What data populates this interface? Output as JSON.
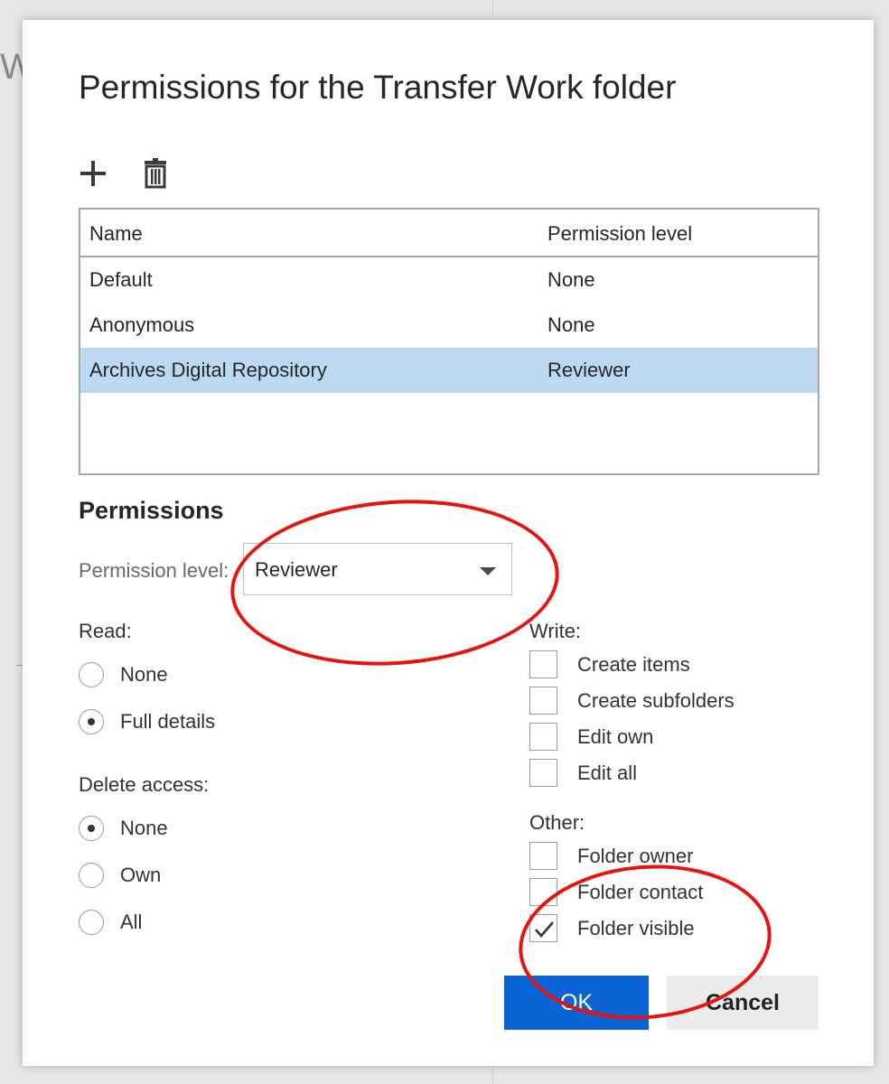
{
  "background": {
    "partial_letter": "W"
  },
  "dialog": {
    "title": "Permissions for the Transfer Work folder",
    "toolbar": {
      "add_icon": "plus-icon",
      "delete_icon": "trash-icon"
    },
    "table": {
      "columns": [
        "Name",
        "Permission level"
      ],
      "rows": [
        {
          "name": "Default",
          "level": "None",
          "selected": false
        },
        {
          "name": "Anonymous",
          "level": "None",
          "selected": false
        },
        {
          "name": "Archives Digital Repository",
          "level": "Reviewer",
          "selected": true
        }
      ]
    },
    "permissions": {
      "section_title": "Permissions",
      "permission_level_label": "Permission level:",
      "permission_level_value": "Reviewer",
      "read": {
        "label": "Read:",
        "options": [
          {
            "label": "None",
            "checked": false
          },
          {
            "label": "Full details",
            "checked": true
          }
        ]
      },
      "delete_access": {
        "label": "Delete access:",
        "options": [
          {
            "label": "None",
            "checked": true
          },
          {
            "label": "Own",
            "checked": false
          },
          {
            "label": "All",
            "checked": false
          }
        ]
      },
      "write": {
        "label": "Write:",
        "options": [
          {
            "label": "Create items",
            "checked": false
          },
          {
            "label": "Create subfolders",
            "checked": false
          },
          {
            "label": "Edit own",
            "checked": false
          },
          {
            "label": "Edit all",
            "checked": false
          }
        ]
      },
      "other": {
        "label": "Other:",
        "options": [
          {
            "label": "Folder owner",
            "checked": false
          },
          {
            "label": "Folder contact",
            "checked": false
          },
          {
            "label": "Folder visible",
            "checked": true
          }
        ]
      }
    },
    "buttons": {
      "ok": "OK",
      "cancel": "Cancel"
    },
    "colors": {
      "accent": "#0a64d6",
      "selected_row": "#bcd9f1",
      "annotation": "#e8130f"
    }
  }
}
